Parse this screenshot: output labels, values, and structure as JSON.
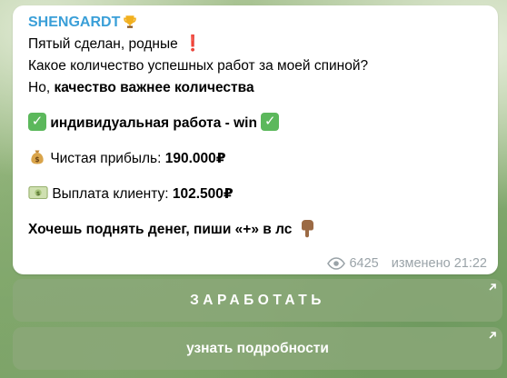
{
  "message": {
    "sender": "SHENGARDT",
    "lines": {
      "l1": "Пятый сделан, родные",
      "l2": "Какое количество успешных работ за моей спиной?",
      "l3_prefix": "Но, ",
      "l3_bold": "качество важнее количества",
      "l4": "индивидуальная работа - win",
      "l5_label": "Чистая прибыль: ",
      "l5_value": "190.000₽",
      "l6_label": "Выплата клиенту: ",
      "l6_value": "102.500₽",
      "l7": "Хочешь поднять денег, пиши «+» в лс"
    },
    "views": "6425",
    "edited_time": "изменено 21:22"
  },
  "buttons": {
    "earn": "ЗАРАБОТАТЬ",
    "details": "узнать подробности"
  },
  "icons": {
    "trophy": "trophy-icon",
    "exclamation": "exclamation-icon",
    "check": "check-mark-icon",
    "money_bag": "money-bag-icon",
    "banknote": "banknote-icon",
    "pointing_down": "pointing-down-icon",
    "eye": "eye-icon",
    "external_link": "external-link-icon"
  },
  "colors": {
    "sender": "#3a9fd8",
    "check_bg": "#5cb85c",
    "exclamation": "#e0202a",
    "meta": "#9aa3a8",
    "button_bg": "#8ca87a"
  }
}
